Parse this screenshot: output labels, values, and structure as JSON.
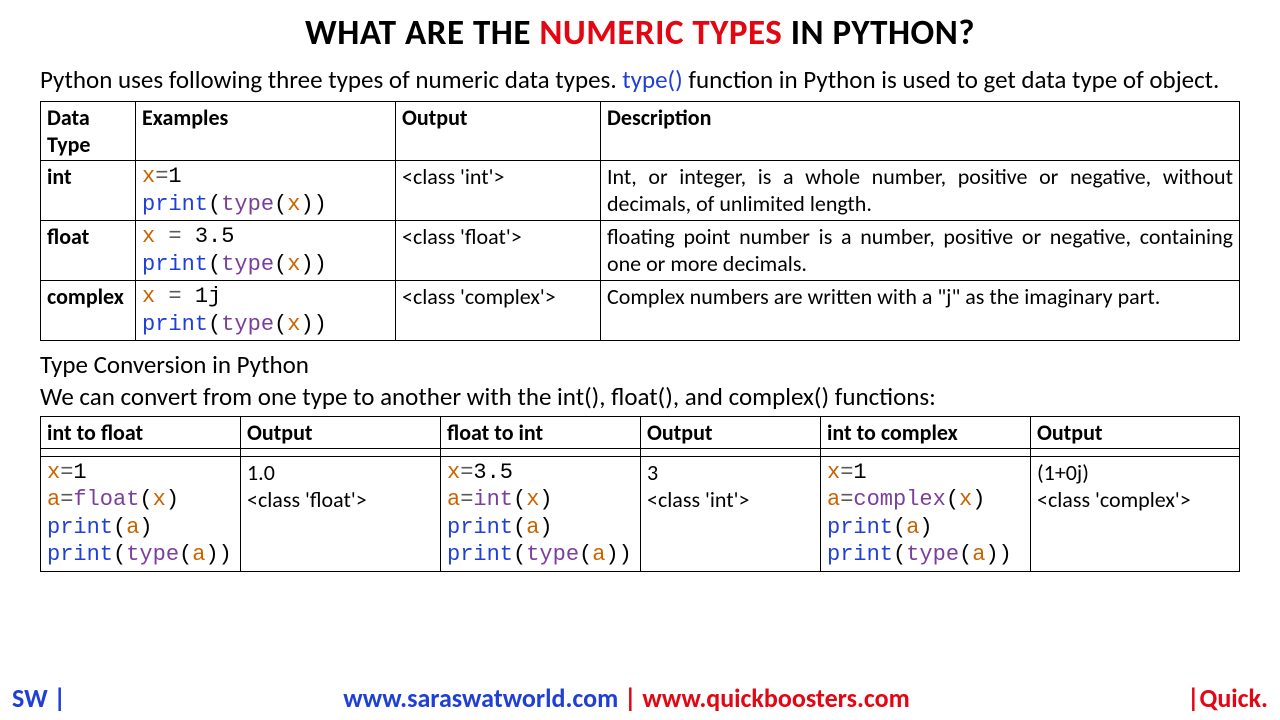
{
  "title": {
    "prefix": "WHAT ARE THE ",
    "highlight": "NUMERIC TYPES",
    "suffix": " IN PYTHON?"
  },
  "intro": {
    "before": "Python uses following three types of numeric data types. ",
    "fn": "type()",
    "after": " function in Python is used to get data type of object."
  },
  "table1": {
    "headers": {
      "c1": "Data Type",
      "c2": "Examples",
      "c3": "Output",
      "c4": "Description"
    },
    "rows": [
      {
        "type": "int",
        "code": {
          "l1_var": "x",
          "l1_op": "=",
          "l1_val": "1",
          "l2_fn": "print",
          "l2_builtin": "type",
          "l2_arg": "x"
        },
        "output": " <class 'int'>",
        "desc": "Int, or integer, is a whole number, positive or negative, without decimals, of unlimited length."
      },
      {
        "type": "float",
        "code": {
          "l1_var": "x",
          "l1_op": " = ",
          "l1_val": "3.5",
          "l2_fn": "print",
          "l2_builtin": "type",
          "l2_arg": "x"
        },
        "output": " <class 'float'>",
        "desc": "floating point number is a number, positive or negative, containing one or more decimals."
      },
      {
        "type": "complex",
        "code": {
          "l1_var": "x",
          "l1_op": " = ",
          "l1_val": "1j",
          "l2_fn": "print",
          "l2_builtin": "type",
          "l2_arg": "x"
        },
        "output": " <class 'complex'>",
        "desc": "Complex numbers are written with a \"j\" as the imaginary part."
      }
    ]
  },
  "section2": {
    "heading": "Type Conversion in Python",
    "text": "We can convert from one type to another with the int(), float(), and complex() functions:"
  },
  "table2": {
    "headers": {
      "c1": "int to float",
      "c2": "Output",
      "c3": "float to int",
      "c4": "Output",
      "c5": "int to complex",
      "c6": "Output"
    },
    "cols": [
      {
        "assign_var": "x",
        "assign_op": "=",
        "assign_val": "1",
        "conv_var": "a",
        "conv_op": "=",
        "conv_fn": "float",
        "conv_arg": "x",
        "p1_fn": "print",
        "p1_arg": "a",
        "p2_fn": "print",
        "p2_builtin": "type",
        "p2_arg": "a",
        "out1": " 1.0",
        "out2": " <class 'float'>"
      },
      {
        "assign_var": "x",
        "assign_op": "=",
        "assign_val": "3.5",
        "conv_var": "a",
        "conv_op": "=",
        "conv_fn": "int",
        "conv_arg": "x",
        "p1_fn": "print",
        "p1_arg": "a",
        "p2_fn": "print",
        "p2_builtin": "type",
        "p2_arg": "a",
        "out1": " 3",
        "out2": " <class 'int'>"
      },
      {
        "assign_var": "x",
        "assign_op": "=",
        "assign_val": "1",
        "conv_var": "a",
        "conv_op": "=",
        "conv_fn": "complex",
        "conv_arg": "x",
        "p1_fn": "print",
        "p1_arg": "a",
        "p2_fn": "print",
        "p2_builtin": "type",
        "p2_arg": "a",
        "out1": " (1+0j)",
        "out2": " <class 'complex'>"
      }
    ]
  },
  "footer": {
    "left": "SW |",
    "mid_blue1": "www.saraswatworld.com",
    "mid_sep": " | ",
    "mid_red": "www.quickboosters.com",
    "right": "|Quick."
  }
}
